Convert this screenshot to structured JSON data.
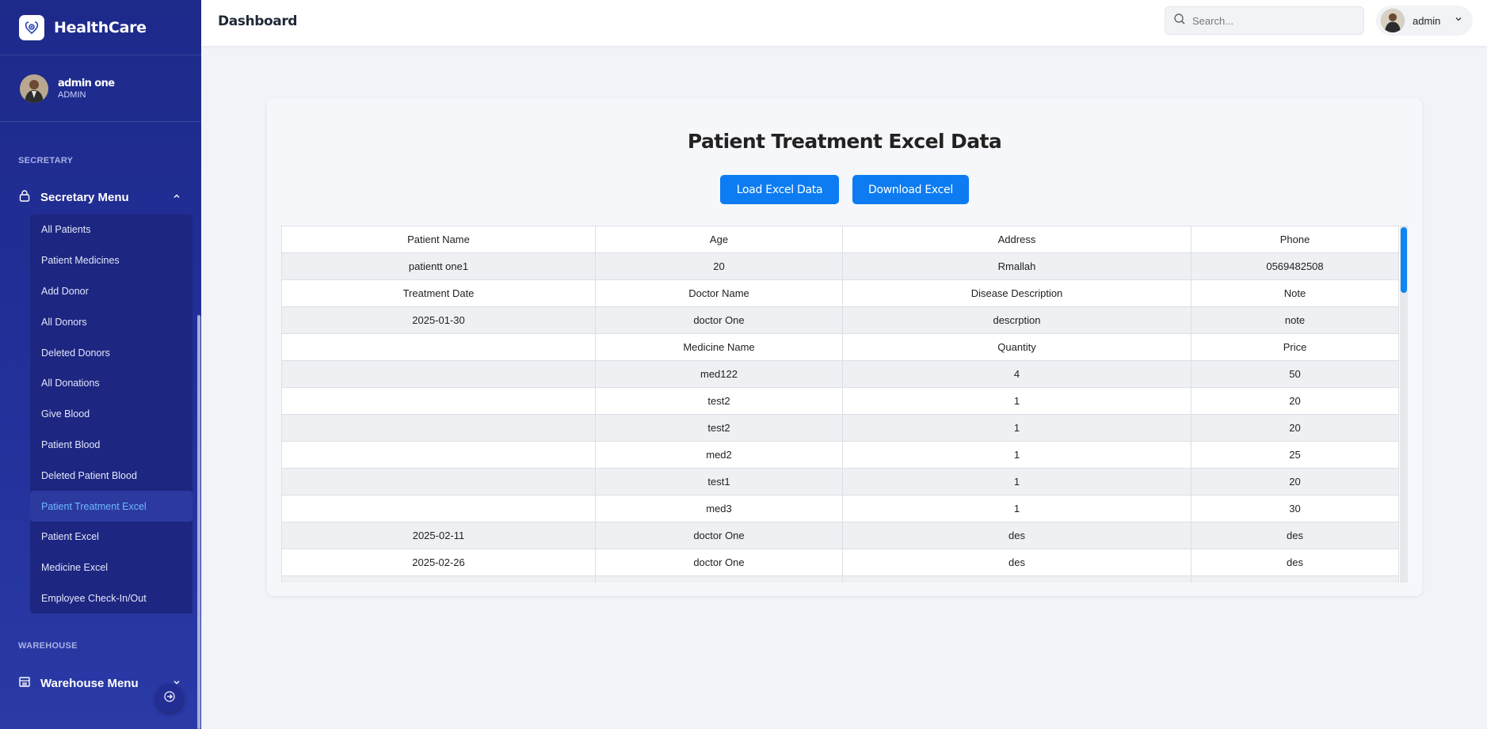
{
  "app": {
    "name": "HealthCare"
  },
  "profile": {
    "name": "admin one",
    "role": "ADMIN"
  },
  "sidebar": {
    "sections": [
      {
        "label": "SECRETARY",
        "menu_label": "Secretary Menu",
        "expanded": true
      },
      {
        "label": "WAREHOUSE",
        "menu_label": "Warehouse Menu",
        "expanded": false
      }
    ],
    "items": [
      {
        "label": "All Patients",
        "active": false
      },
      {
        "label": "Patient Medicines",
        "active": false
      },
      {
        "label": "Add Donor",
        "active": false
      },
      {
        "label": "All Donors",
        "active": false
      },
      {
        "label": "Deleted Donors",
        "active": false
      },
      {
        "label": "All Donations",
        "active": false
      },
      {
        "label": "Give Blood",
        "active": false
      },
      {
        "label": "Patient Blood",
        "active": false
      },
      {
        "label": "Deleted Patient Blood",
        "active": false
      },
      {
        "label": "Patient Treatment Excel",
        "active": true
      },
      {
        "label": "Patient Excel",
        "active": false
      },
      {
        "label": "Medicine Excel",
        "active": false
      },
      {
        "label": "Employee Check-In/Out",
        "active": false
      }
    ]
  },
  "topbar": {
    "title": "Dashboard",
    "search_placeholder": "Search...",
    "user_name": "admin"
  },
  "main": {
    "title": "Patient Treatment Excel Data",
    "load_button": "Load Excel Data",
    "download_button": "Download Excel",
    "table_rows": [
      [
        "Patient Name",
        "Age",
        "Address",
        "Phone"
      ],
      [
        "patientt one1",
        "20",
        "Rmallah",
        "0569482508"
      ],
      [
        "Treatment Date",
        "Doctor Name",
        "Disease Description",
        "Note"
      ],
      [
        "2025-01-30",
        "doctor One",
        "descrption",
        "note"
      ],
      [
        "",
        "Medicine Name",
        "Quantity",
        "Price"
      ],
      [
        "",
        "med122",
        "4",
        "50"
      ],
      [
        "",
        "test2",
        "1",
        "20"
      ],
      [
        "",
        "test2",
        "1",
        "20"
      ],
      [
        "",
        "med2",
        "1",
        "25"
      ],
      [
        "",
        "test1",
        "1",
        "20"
      ],
      [
        "",
        "med3",
        "1",
        "30"
      ],
      [
        "2025-02-11",
        "doctor One",
        "des",
        "des"
      ],
      [
        "2025-02-26",
        "doctor One",
        "des",
        "des"
      ],
      [
        "",
        "",
        "",
        ""
      ]
    ]
  },
  "colors": {
    "sidebar": "#1e2a8a",
    "accent": "#0d7cf2",
    "active_item_text": "#6fb8ff"
  }
}
